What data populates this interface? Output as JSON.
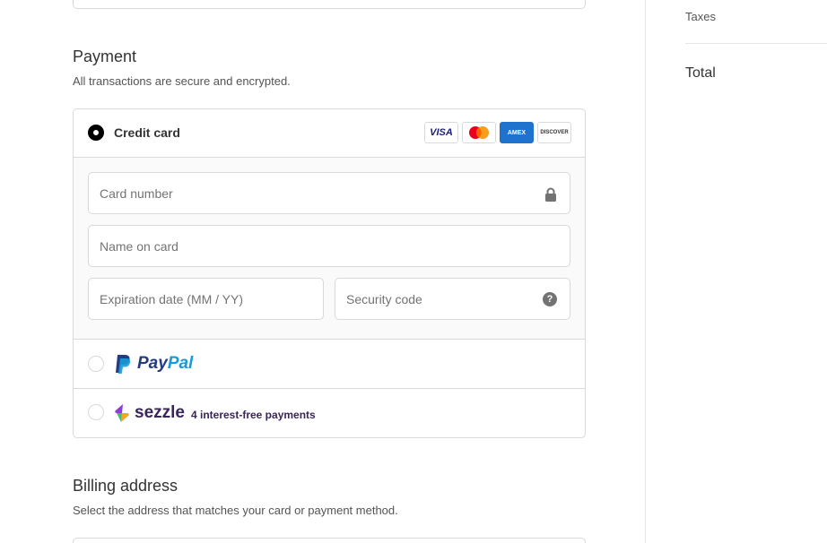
{
  "payment": {
    "title": "Payment",
    "subtitle": "All transactions are secure and encrypted.",
    "credit_card": {
      "label": "Credit card",
      "selected": true,
      "card_brands": [
        "VISA",
        "mastercard",
        "AMEX",
        "DISCOVER"
      ],
      "fields": {
        "card_number": {
          "value": "",
          "placeholder": "Card number"
        },
        "name_on_card": {
          "value": "",
          "placeholder": "Name on card"
        },
        "expiration": {
          "value": "",
          "placeholder": "Expiration date (MM / YY)"
        },
        "security_code": {
          "value": "",
          "placeholder": "Security code"
        }
      }
    },
    "paypal": {
      "word_dark": "Pay",
      "word_light": "Pal",
      "selected": false
    },
    "sezzle": {
      "word": "sezzle",
      "tagline": "4 interest-free payments",
      "selected": false
    }
  },
  "billing": {
    "title": "Billing address",
    "subtitle": "Select the address that matches your card or payment method."
  },
  "summary": {
    "taxes_label": "Taxes",
    "total_label": "Total"
  },
  "colors": {
    "border": "#d9d9d9",
    "panel_bg": "#fafafa",
    "paypal_dark": "#253b80",
    "paypal_light": "#179bd7",
    "sezzle_purple": "#392558",
    "amex_blue": "#1f72cd"
  },
  "icons": {
    "lock": "lock-icon",
    "help": "question-circle-icon"
  }
}
